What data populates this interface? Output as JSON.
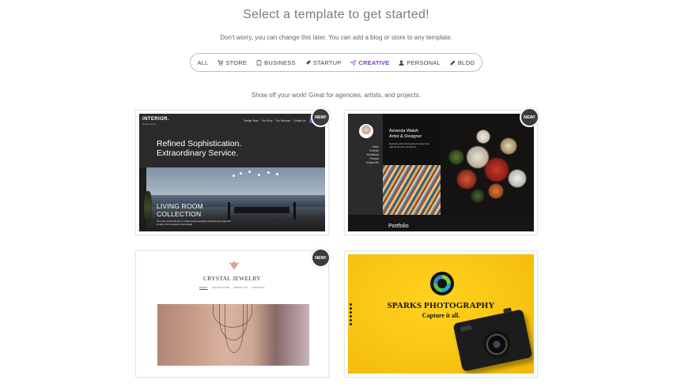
{
  "header": {
    "title": "Select a template to get started!",
    "subtitle": "Don't worry, you can change this later. You can add a blog or store to any template."
  },
  "filters": [
    {
      "label": "ALL",
      "icon": "",
      "active": false
    },
    {
      "label": "STORE",
      "icon": "cart-icon",
      "active": false
    },
    {
      "label": "BUSINESS",
      "icon": "briefcase-icon",
      "active": false
    },
    {
      "label": "STARTUP",
      "icon": "rocket-icon",
      "active": false
    },
    {
      "label": "CREATIVE",
      "icon": "paper-plane-icon",
      "active": true
    },
    {
      "label": "PERSONAL",
      "icon": "person-icon",
      "active": false
    },
    {
      "label": "BLOG",
      "icon": "pencil-icon",
      "active": false
    }
  ],
  "category_description": "Show off your work! Great for agencies, artists, and projects.",
  "colors": {
    "accent": "#7c3fbf",
    "badge": "#3b3b3b",
    "yellow": "#f9c512"
  },
  "templates": [
    {
      "badge": "NEW!",
      "logo": "INTERIOR.",
      "logo_sub": "design studio",
      "nav": [
        "Design Team",
        "Our Story",
        "Our Services",
        "Contact Us"
      ],
      "nav_button": "Call Us",
      "headline": [
        "Refined Sophistication.",
        "Extraordinary Service."
      ],
      "section_title": [
        "LIVING ROOM",
        "COLLECTION"
      ],
      "section_body": "Our team works with you to create spaces perfectly reflecting your style and comfort, from concept to final details."
    },
    {
      "badge": "NEW!",
      "menu": [
        "Home",
        "Portfolio",
        "Exhibitions",
        "Process",
        "Contact Me"
      ],
      "name": [
        "Amanda Walsh",
        "Artist & Designer"
      ],
      "tagline": "Exploring the intersection between the natural and the unnatural.",
      "footer": "Portfolio"
    },
    {
      "badge": "NEW!",
      "brand": "CRYSTAL JEWELRY",
      "nav": [
        "HOME",
        "COLLECTION",
        "ABOUT US",
        "CONTACT"
      ]
    },
    {
      "title": "SPARKS PHOTOGRAPHY",
      "subtitle": "Capture it all."
    }
  ]
}
